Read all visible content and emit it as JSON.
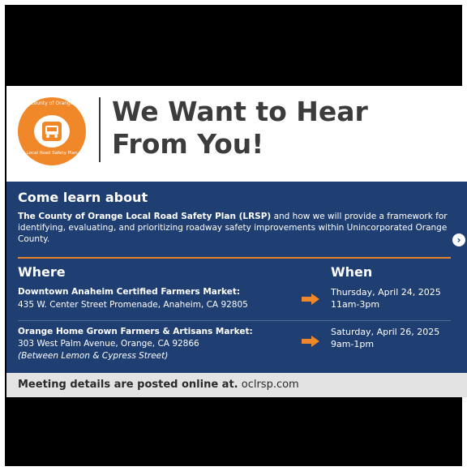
{
  "header": {
    "logo_ring_top": "County of Orange",
    "logo_ring_bottom": "Local Road Safety Plan",
    "headline_line1": "We Want to Hear",
    "headline_line2": "From You!"
  },
  "intro": {
    "heading": "Come learn about",
    "bold_lead": "The County of Orange Local Road Safety Plan (LRSP)",
    "rest": " and how we will provide a framework for identifying, evaluating, and prioritizing roadway safety improvements within Unincorporated Orange County."
  },
  "table": {
    "where_header": "Where",
    "when_header": "When",
    "events": [
      {
        "name": "Downtown Anaheim Certified Farmers Market:",
        "address": "435 W. Center Street Promenade, Anaheim, CA 92805",
        "note": "",
        "date": "Thursday, April 24, 2025",
        "time": "11am-3pm"
      },
      {
        "name": "Orange Home Grown Farmers & Artisans Market:",
        "address": "303 West Palm Avenue, Orange, CA 92866",
        "note": "(Between Lemon & Cypress Street)",
        "date": "Saturday, April 26, 2025",
        "time": "9am-1pm"
      }
    ]
  },
  "footer": {
    "lead": "Meeting details are posted online at.",
    "url": " oclrsp.com"
  },
  "colors": {
    "navy": "#1f3e72",
    "orange": "#f0882a",
    "footer_bg": "#e3e3e3"
  }
}
